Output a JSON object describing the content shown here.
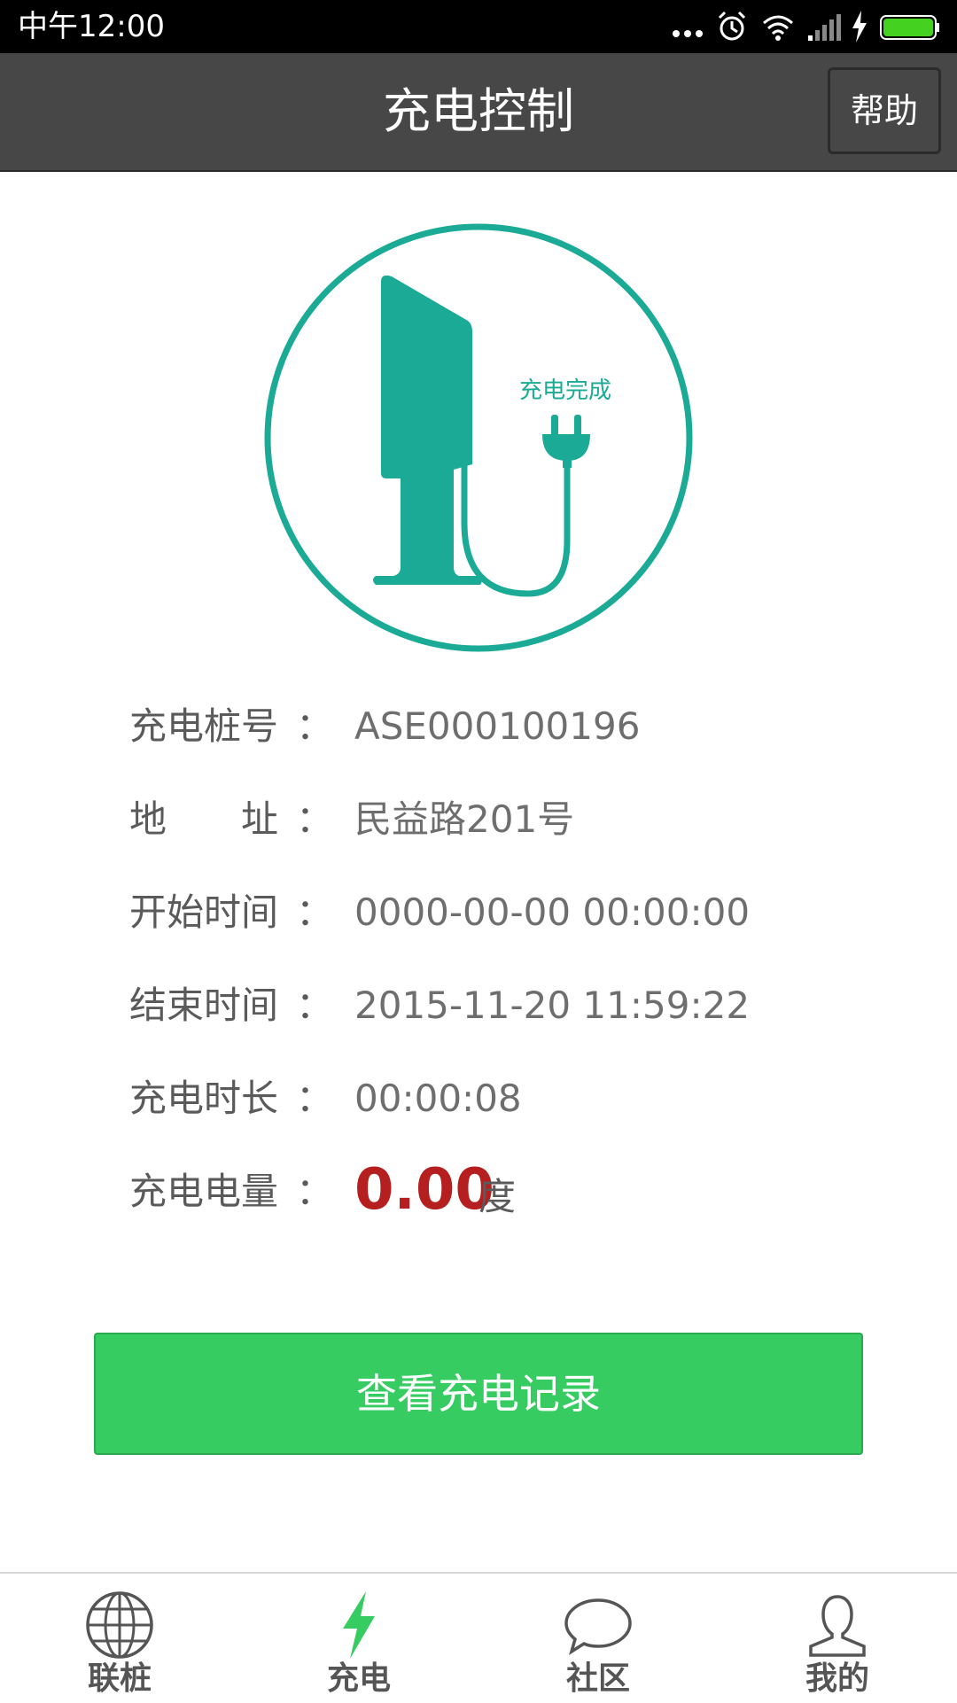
{
  "status_bar": {
    "time": "中午12:00"
  },
  "header": {
    "title": "充电控制",
    "help_label": "帮助"
  },
  "status": {
    "caption": "充电完成",
    "accent_color": "#1aaa95"
  },
  "info": {
    "pile_no": {
      "label": "充电桩号",
      "value": "ASE000100196"
    },
    "address": {
      "label": "地　　址",
      "value": "民益路201号"
    },
    "start_time": {
      "label": "开始时间",
      "value": "0000-00-00 00:00:00"
    },
    "end_time": {
      "label": "结束时间",
      "value": "2015-11-20 11:59:22"
    },
    "duration": {
      "label": "充电时长",
      "value": "00:00:08"
    },
    "energy": {
      "label": "充电电量",
      "value": "0.00",
      "unit": "度",
      "color": "#b51f1f"
    },
    "colon": "："
  },
  "records_button": {
    "label": "查看充电记录",
    "color": "#36cc62"
  },
  "tabs": [
    {
      "label": "联桩",
      "icon": "globe-icon",
      "active": false
    },
    {
      "label": "充电",
      "icon": "lightning-icon",
      "active": true
    },
    {
      "label": "社区",
      "icon": "speech-bubble-icon",
      "active": false
    },
    {
      "label": "我的",
      "icon": "person-icon",
      "active": false
    }
  ]
}
